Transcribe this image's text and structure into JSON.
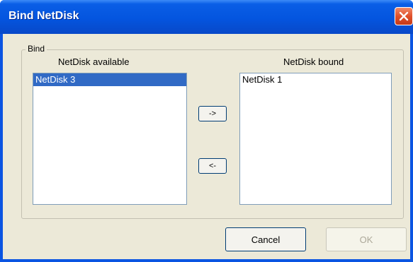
{
  "window": {
    "title": "Bind NetDisk"
  },
  "group": {
    "label": "Bind"
  },
  "available": {
    "label": "NetDisk available",
    "items": [
      {
        "label": "NetDisk 3",
        "selected": true
      }
    ]
  },
  "bound": {
    "label": "NetDisk bound",
    "items": [
      {
        "label": "NetDisk 1",
        "selected": false
      }
    ]
  },
  "buttons": {
    "move_right": "->",
    "move_left": "<-",
    "cancel": "Cancel",
    "ok": "OK"
  },
  "icons": {
    "close": "close-icon"
  }
}
